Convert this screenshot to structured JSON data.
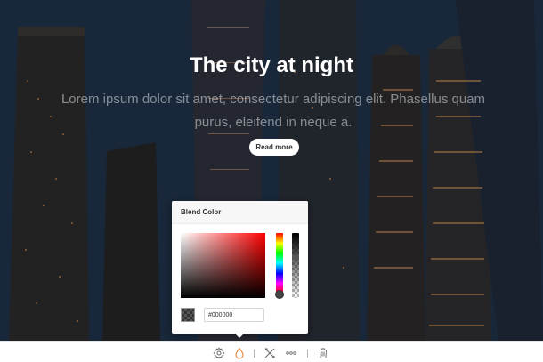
{
  "hero": {
    "headline": "The city at night",
    "lead": "Lorem ipsum dolor sit amet, consectetur adipiscing elit. Phasellus quam purus, eleifend in neque a.",
    "cta_label": "Read more"
  },
  "blend_popover": {
    "title": "Blend Color",
    "hex_value": "#000000",
    "swatch_color": "#000000",
    "hue_level": 1.0,
    "alpha_level": 0.35
  },
  "toolbar": {
    "items": [
      {
        "icon": "gear-icon"
      },
      {
        "icon": "drop-icon",
        "active": true
      },
      {
        "icon": "tools-icon"
      },
      {
        "icon": "more-icon"
      },
      {
        "icon": "trash-icon"
      }
    ],
    "accent_color": "#e8843c",
    "icon_color": "#666666"
  }
}
